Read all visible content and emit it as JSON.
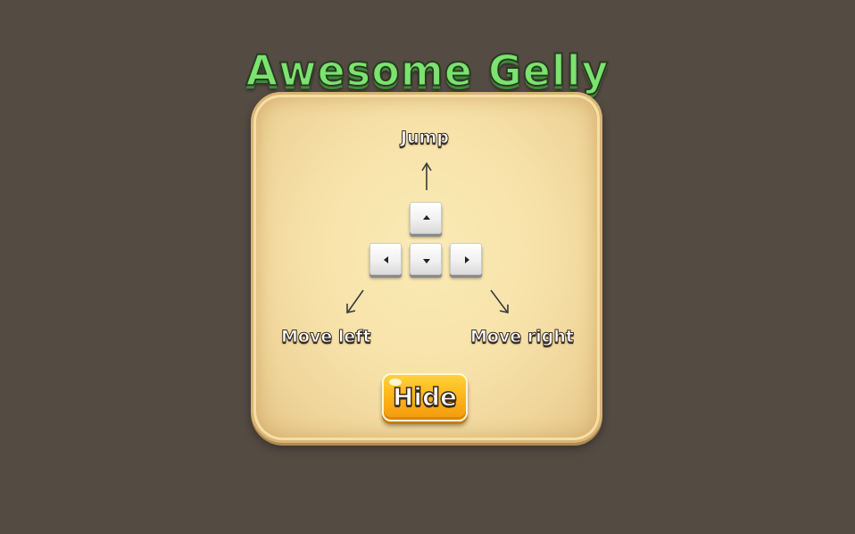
{
  "game": {
    "title": "Awesome Gelly"
  },
  "controls": {
    "jump_label": "Jump",
    "move_left_label": "Move left",
    "move_right_label": "Move right",
    "keys": [
      {
        "name": "up",
        "icon": "arrow-up-icon"
      },
      {
        "name": "left",
        "icon": "arrow-left-icon"
      },
      {
        "name": "down",
        "icon": "arrow-down-icon"
      },
      {
        "name": "right",
        "icon": "arrow-right-icon"
      }
    ]
  },
  "buttons": {
    "hide_label": "Hide"
  },
  "colors": {
    "background": "#544b43",
    "title": "#7be36e",
    "panel": "#f7e3aa",
    "button": "#fbb41a"
  }
}
